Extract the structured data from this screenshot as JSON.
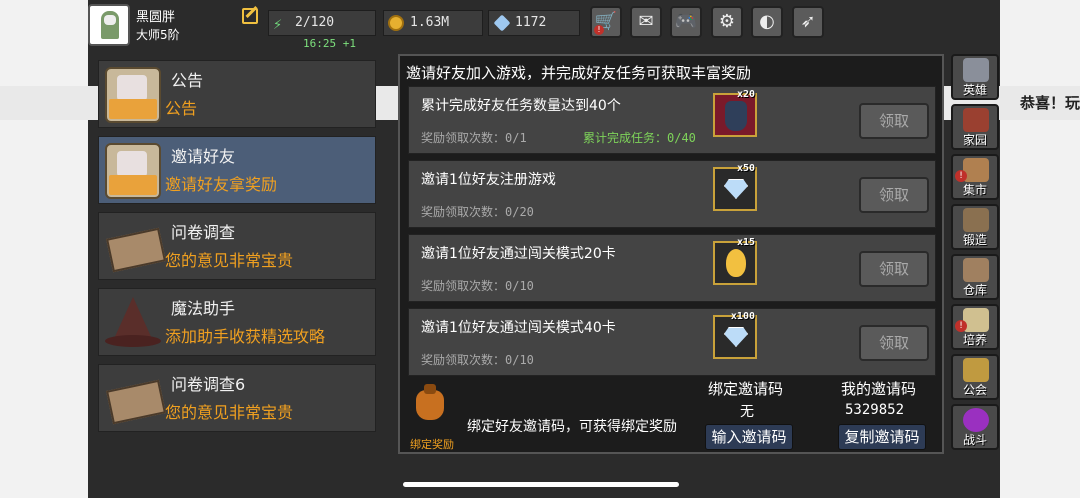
{
  "player": {
    "name": "黑圆胖",
    "rank": "大师5阶"
  },
  "stats": {
    "energy": "2/120",
    "gold": "1.63M",
    "gems": "1172",
    "timer": "16:25 +1"
  },
  "top_buttons": [
    {
      "name": "shop",
      "glyph": "🛒",
      "alert": "!"
    },
    {
      "name": "mail",
      "glyph": "✉"
    },
    {
      "name": "gamepad",
      "glyph": "🎮"
    },
    {
      "name": "settings",
      "glyph": "⚙"
    },
    {
      "name": "color-wheel",
      "glyph": "◐"
    },
    {
      "name": "feather",
      "glyph": "➶"
    }
  ],
  "ticker": "恭喜！玩",
  "menu": [
    {
      "title": "公告",
      "sub": "公告",
      "icon": "note"
    },
    {
      "title": "邀请好友",
      "sub": "邀请好友拿奖励",
      "icon": "note"
    },
    {
      "title": "问卷调查",
      "sub": "您的意见非常宝贵",
      "icon": "sheet"
    },
    {
      "title": "魔法助手",
      "sub": "添加助手收获精选攻略",
      "icon": "hat"
    },
    {
      "title": "问卷调查6",
      "sub": "您的意见非常宝贵",
      "icon": "sheet"
    }
  ],
  "panel": {
    "title": "邀请好友加入游戏，并完成好友任务可获取丰富奖励",
    "claim_label": "领取",
    "tasks": [
      {
        "title": "累计完成好友任务数量达到40个",
        "count": "奖励领取次数：0/1",
        "progress": "累计完成任务：0/40",
        "reward_qty": "x20",
        "reward": "potion"
      },
      {
        "title": "邀请1位好友注册游戏",
        "count": "奖励领取次数：0/20",
        "reward_qty": "x50",
        "reward": "gem"
      },
      {
        "title": "邀请1位好友通过闯关模式20卡",
        "count": "奖励领取次数：0/10",
        "reward_qty": "x15",
        "reward": "egg"
      },
      {
        "title": "邀请1位好友通过闯关模式40卡",
        "count": "奖励领取次数：0/10",
        "reward_qty": "x100",
        "reward": "gem"
      }
    ]
  },
  "invite": {
    "bag_label": "绑定奖励",
    "hint": "绑定好友邀请码，可获得绑定奖励",
    "bound_code_head": "绑定邀请码",
    "bound_code_value": "无",
    "my_code_head": "我的邀请码",
    "my_code_value": "5329852",
    "enter_button": "输入邀请码",
    "copy_button": "复制邀请码"
  },
  "right_nav": [
    {
      "label": "英雄",
      "color": "#8a8f9a"
    },
    {
      "label": "家园",
      "color": "#9a4030"
    },
    {
      "label": "集市",
      "color": "#b08050",
      "alert": "!"
    },
    {
      "label": "锻造",
      "color": "#8a7050"
    },
    {
      "label": "仓库",
      "color": "#a08060"
    },
    {
      "label": "培养",
      "color": "#d0c090",
      "alert": "!"
    },
    {
      "label": "公会",
      "color": "#c09a40"
    },
    {
      "label": "战斗",
      "color": "#9a30c0"
    }
  ]
}
